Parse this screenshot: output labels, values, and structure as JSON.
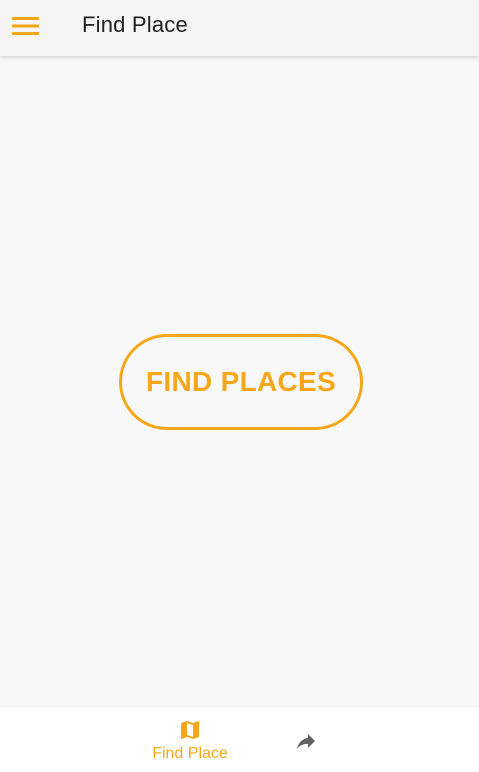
{
  "toolbar": {
    "menu_icon": "hamburger-menu-icon",
    "title": "Find Place"
  },
  "main": {
    "find_button_label": "FIND PLACES"
  },
  "bottom_nav": {
    "items": [
      {
        "label": "Find Place",
        "icon": "map-icon",
        "active": true
      },
      {
        "label": "",
        "icon": "share-icon",
        "active": false
      }
    ]
  },
  "colors": {
    "accent": "#f6a719",
    "title_text": "#222222",
    "inactive_icon": "#616161",
    "background": "#f8f8f8"
  }
}
